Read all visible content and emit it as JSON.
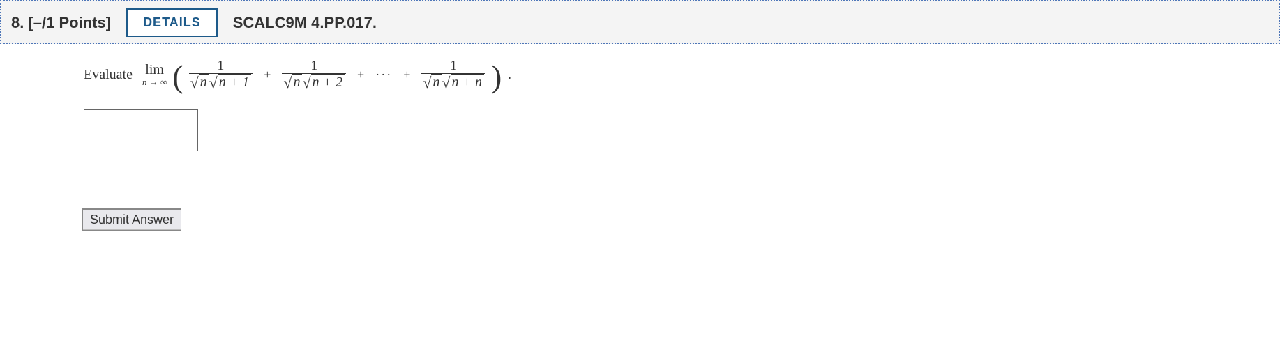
{
  "header": {
    "number": "8.",
    "points": "[–/1 Points]",
    "details_label": "DETAILS",
    "code": "SCALC9M 4.PP.017."
  },
  "prompt": {
    "prefix": "Evaluate",
    "lim_top": "lim",
    "lim_bot": "n → ∞",
    "term1_num": "1",
    "term1_den_outer_var": "n",
    "term1_den_inner": "n + 1",
    "term2_num": "1",
    "term2_den_outer_var": "n",
    "term2_den_inner": "n + 2",
    "ellipsis": "···",
    "term3_num": "1",
    "term3_den_outer_var": "n",
    "term3_den_inner": "n + n",
    "plus": "+",
    "period": "."
  },
  "answer": {
    "value": ""
  },
  "submit_label": "Submit Answer"
}
